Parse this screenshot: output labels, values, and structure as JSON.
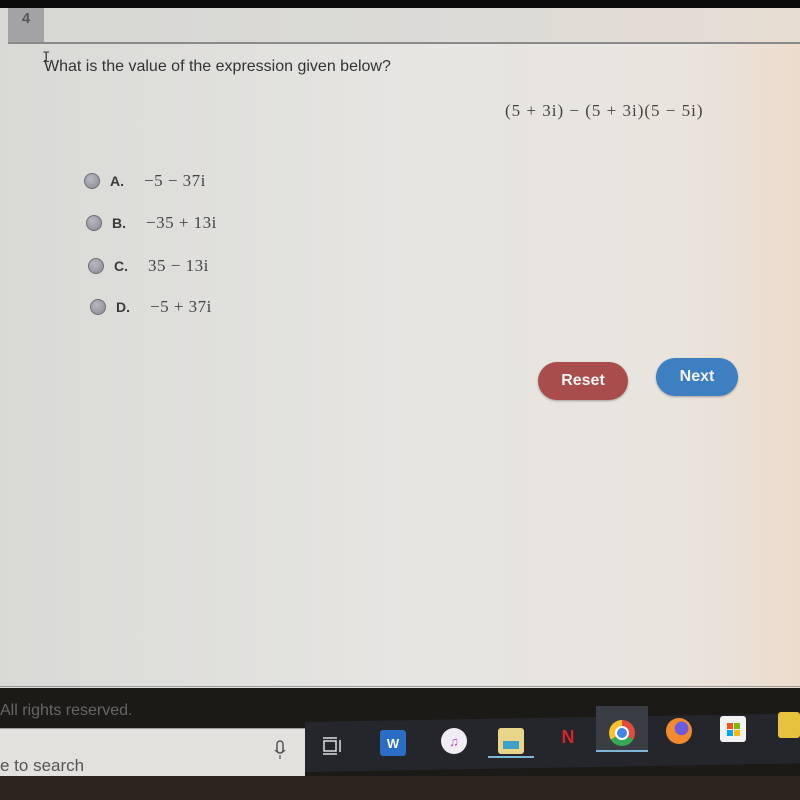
{
  "question": {
    "number": "4",
    "prompt": "What is the value of the expression given below?",
    "expression": "(5 + 3i) − (5 + 3i)(5 − 5i)",
    "choices": [
      {
        "letter": "A.",
        "value": "−5 − 37i"
      },
      {
        "letter": "B.",
        "value": "−35 + 13i"
      },
      {
        "letter": "C.",
        "value": "35 − 13i"
      },
      {
        "letter": "D.",
        "value": "−5 + 37i"
      }
    ]
  },
  "buttons": {
    "reset": "Reset",
    "next": "Next"
  },
  "colors": {
    "reset": "#a84c4c",
    "next": "#3e7fc1"
  },
  "footer": {
    "copyright": "All rights reserved."
  },
  "taskbar": {
    "search_placeholder": "e to search",
    "apps": [
      {
        "name": "word-icon",
        "glyph": "W"
      },
      {
        "name": "itunes-icon",
        "glyph": "♫"
      },
      {
        "name": "file-explorer-icon",
        "glyph": ""
      },
      {
        "name": "netflix-icon",
        "glyph": "N"
      },
      {
        "name": "chrome-icon",
        "glyph": ""
      },
      {
        "name": "firefox-icon",
        "glyph": ""
      },
      {
        "name": "store-icon",
        "glyph": ""
      },
      {
        "name": "sticky-notes-icon",
        "glyph": ""
      }
    ]
  }
}
